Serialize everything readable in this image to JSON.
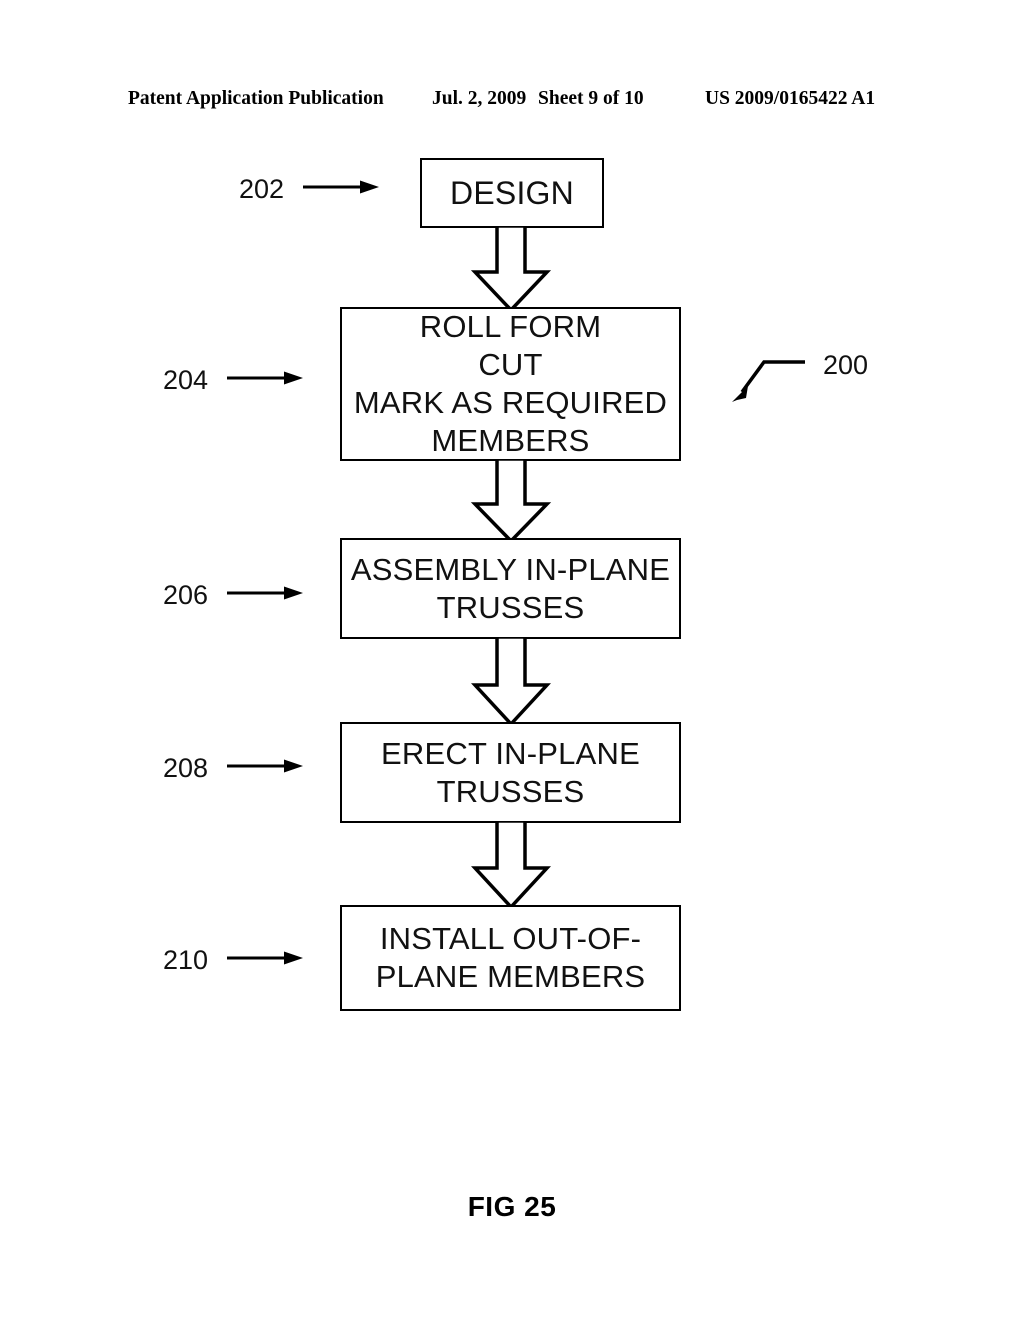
{
  "header": {
    "publication": "Patent Application Publication",
    "date": "Jul. 2, 2009",
    "sheet": "Sheet 9 of 10",
    "patent_number": "US 2009/0165422 A1"
  },
  "figure": {
    "caption": "FIG 25",
    "diagram_label": "200"
  },
  "flowchart": {
    "steps": [
      {
        "ref": "202",
        "text": "DESIGN"
      },
      {
        "ref": "204",
        "text": "ROLL FORM\nCUT\nMARK AS REQUIRED\nMEMBERS"
      },
      {
        "ref": "206",
        "text": "ASSEMBLY IN-PLANE\nTRUSSES"
      },
      {
        "ref": "208",
        "text": "ERECT IN-PLANE\nTRUSSES"
      },
      {
        "ref": "210",
        "text": "INSTALL OUT-OF-\nPLANE MEMBERS"
      }
    ]
  },
  "colors": {
    "ink": "#000000",
    "paper": "#ffffff"
  }
}
